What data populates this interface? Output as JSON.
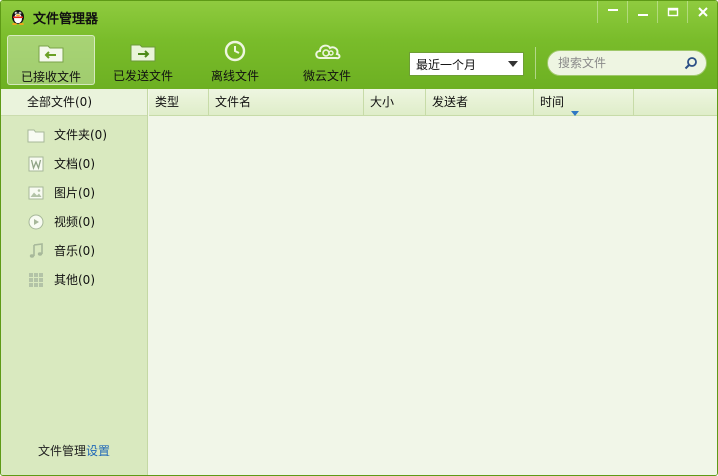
{
  "app": {
    "title": "文件管理器",
    "icon": "qq-penguin-icon"
  },
  "window_controls": [
    {
      "name": "menu",
      "icon": "menu-bar-icon"
    },
    {
      "name": "minimize",
      "icon": "minimize-icon"
    },
    {
      "name": "maximize",
      "icon": "maximize-icon"
    },
    {
      "name": "close",
      "icon": "close-icon"
    }
  ],
  "toolbar": {
    "buttons": [
      {
        "label": "已接收文件",
        "icon": "received-folder-icon",
        "active": true
      },
      {
        "label": "已发送文件",
        "icon": "sent-folder-icon",
        "active": false
      },
      {
        "label": "离线文件",
        "icon": "offline-clock-icon",
        "active": false
      },
      {
        "label": "微云文件",
        "icon": "weiyun-cloud-icon",
        "active": false
      }
    ],
    "time_filter": {
      "value": "最近一个月"
    },
    "search": {
      "placeholder": "搜索文件"
    }
  },
  "sidebar": {
    "all_files": "全部文件(0)",
    "items": [
      {
        "label": "文件夹(0)",
        "icon": "folder-icon"
      },
      {
        "label": "文档(0)",
        "icon": "document-icon"
      },
      {
        "label": "图片(0)",
        "icon": "image-icon"
      },
      {
        "label": "视频(0)",
        "icon": "video-icon"
      },
      {
        "label": "音乐(0)",
        "icon": "music-icon"
      },
      {
        "label": "其他(0)",
        "icon": "other-grid-icon"
      }
    ],
    "footer": {
      "text": "文件管理",
      "link": "设置"
    }
  },
  "table": {
    "columns": [
      "类型",
      "文件名",
      "大小",
      "发送者",
      "时间",
      ""
    ],
    "rows": []
  },
  "colors": {
    "accent": "#7abd2b",
    "link": "#1f68b7",
    "sidebar": "#d9e9bf",
    "content": "#f1f6e8"
  }
}
